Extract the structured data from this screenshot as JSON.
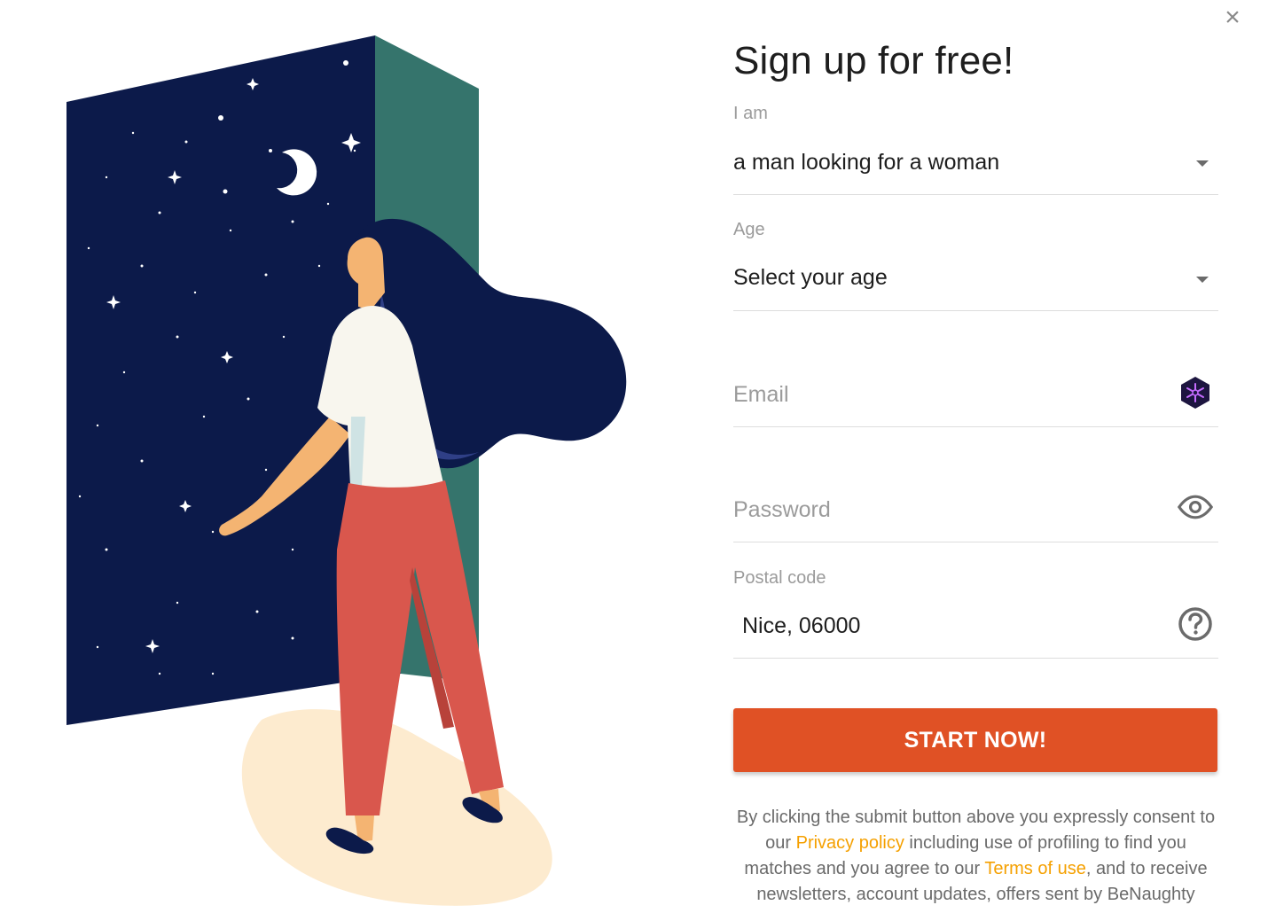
{
  "dialog": {
    "close_label": "×"
  },
  "form": {
    "title": "Sign up for free!",
    "i_am": {
      "label": "I am",
      "value": "a man looking for a woman"
    },
    "age": {
      "label": "Age",
      "value": "Select your age"
    },
    "email": {
      "placeholder": "Email",
      "value": ""
    },
    "password": {
      "placeholder": "Password",
      "value": ""
    },
    "postal_code": {
      "label": "Postal code",
      "value": "Nice, 06000"
    },
    "submit_label": "START NOW!"
  },
  "consent": {
    "text_1": "By clicking the submit button above you expressly consent to our ",
    "privacy_link": "Privacy policy",
    "text_2": " including use of profiling to find you matches and you agree to our ",
    "terms_link": "Terms of use",
    "text_3": ", and to receive newsletters, account updates, offers sent by BeNaughty"
  },
  "icons": {
    "close": "close-icon",
    "dropdown": "chevron-down-icon",
    "email_extension": "password-manager-icon",
    "show_password": "eye-icon",
    "postal_help": "question-circle-icon"
  },
  "colors": {
    "accent": "#e05125",
    "link": "#f5a000",
    "night_sky": "#0c1a4a",
    "door_wall": "#35746c",
    "pants": "#d9574d",
    "floor": "#fdebcf"
  }
}
